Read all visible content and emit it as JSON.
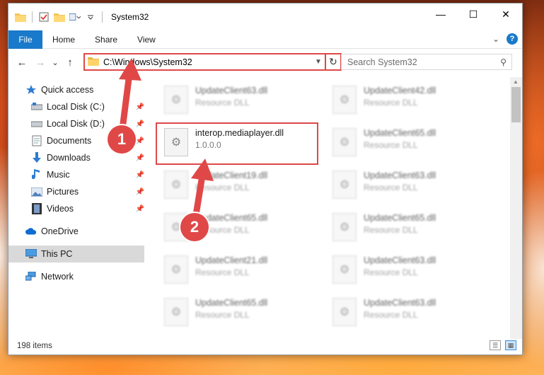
{
  "window": {
    "title": "System32",
    "controls": {
      "minimize": "—",
      "maximize": "☐",
      "close": "✕"
    }
  },
  "ribbon": {
    "file": "File",
    "tabs": [
      "Home",
      "Share",
      "View"
    ],
    "expand": "⌄",
    "help": "?"
  },
  "nav": {
    "back": "←",
    "forward": "→",
    "recent": "⌄",
    "up": "↑",
    "address": "C:\\Windows\\System32",
    "refresh": "↻",
    "search_placeholder": "Search System32",
    "search_icon": "⚲"
  },
  "sidebar": {
    "quick_access": "Quick access",
    "items": [
      {
        "label": "Local Disk (C:)",
        "icon": "drive-icon"
      },
      {
        "label": "Local Disk (D:)",
        "icon": "drive-icon"
      },
      {
        "label": "Documents",
        "icon": "documents-icon"
      },
      {
        "label": "Downloads",
        "icon": "downloads-icon"
      },
      {
        "label": "Music",
        "icon": "music-icon"
      },
      {
        "label": "Pictures",
        "icon": "pictures-icon"
      },
      {
        "label": "Videos",
        "icon": "videos-icon"
      }
    ],
    "onedrive": "OneDrive",
    "thispc": "This PC",
    "network": "Network"
  },
  "files": {
    "left": [
      {
        "name": "UpdateClient63.dll",
        "sub": "Resource DLL"
      },
      {
        "name": "interop.mediaplayer.dll",
        "sub": "1.0.0.0"
      },
      {
        "name": "UpdateClient19.dll",
        "sub": "Resource DLL"
      },
      {
        "name": "UpdateClient65.dll",
        "sub": "Resource DLL"
      },
      {
        "name": "UpdateClient21.dll",
        "sub": "Resource DLL"
      },
      {
        "name": "UpdateClient65.dll",
        "sub": "Resource DLL"
      }
    ],
    "right": [
      {
        "name": "UpdateClient42.dll",
        "sub": "Resource DLL"
      },
      {
        "name": "UpdateClient65.dll",
        "sub": "Resource DLL"
      },
      {
        "name": "UpdateClient63.dll",
        "sub": "Resource DLL"
      },
      {
        "name": "UpdateClient65.dll",
        "sub": "Resource DLL"
      },
      {
        "name": "UpdateClient63.dll",
        "sub": "Resource DLL"
      },
      {
        "name": "UpdateClient63.dll",
        "sub": "Resource DLL"
      }
    ]
  },
  "status": {
    "count": "198 items"
  },
  "annotations": {
    "step1": "1",
    "step2": "2"
  },
  "colors": {
    "accent": "#1979ca",
    "annotation": "#e04848"
  }
}
